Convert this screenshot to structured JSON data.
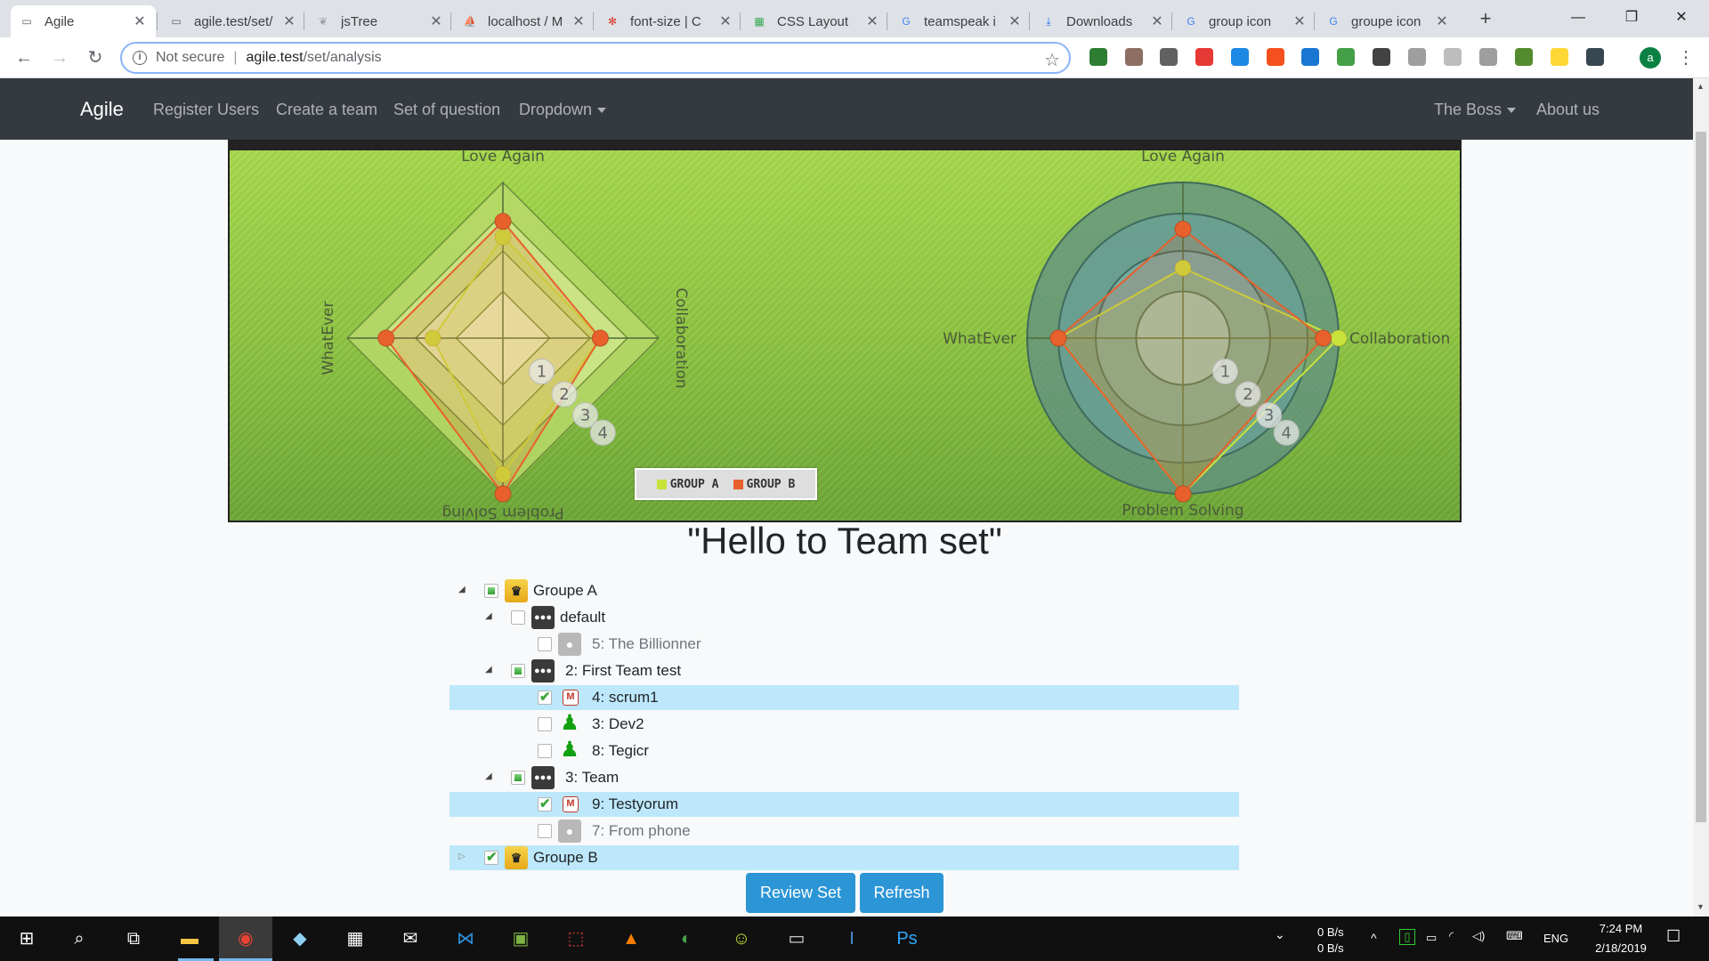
{
  "browser": {
    "tabs": [
      {
        "title": "Agile",
        "icon": "page-icon"
      },
      {
        "title": "agile.test/set/",
        "icon": "page-icon"
      },
      {
        "title": "jsTree",
        "icon": "jstree-icon"
      },
      {
        "title": "localhost / M",
        "icon": "phpmyadmin-icon"
      },
      {
        "title": "font-size | C",
        "icon": "codepen-icon"
      },
      {
        "title": "CSS Layout",
        "icon": "css-icon"
      },
      {
        "title": "teamspeak i",
        "icon": "google-icon"
      },
      {
        "title": "Downloads",
        "icon": "download-icon"
      },
      {
        "title": "group icon",
        "icon": "google-icon"
      },
      {
        "title": "groupe icon",
        "icon": "google-icon"
      }
    ],
    "address": {
      "security": "Not secure",
      "host": "agile.test",
      "path": "/set/analysis"
    },
    "profile_initial": "a",
    "colors": {
      "tabstrip": "#dee1e6",
      "omnibox_border": "#8ab4f8"
    }
  },
  "navbar": {
    "brand": "Agile",
    "links": [
      "Register Users",
      "Create a team",
      "Set of question",
      "Dropdown"
    ],
    "right_links": [
      "The Boss",
      "About us"
    ],
    "bg": "#343a40"
  },
  "chart_data": [
    {
      "type": "radar",
      "shape": "diamond",
      "axes": [
        "Love Again",
        "Collaboration",
        "Problem Solving",
        "WhatEver"
      ],
      "rings": [
        "1",
        "2",
        "3",
        "4"
      ],
      "max": 4,
      "series": [
        {
          "name": "GROUP A",
          "color": "#c8e23c",
          "values": [
            2.6,
            2.5,
            3.5,
            1.8
          ]
        },
        {
          "name": "GROUP B",
          "color": "#e8602c",
          "values": [
            3.0,
            2.5,
            4.0,
            3.0
          ]
        }
      ]
    },
    {
      "type": "radar",
      "shape": "circle",
      "axes": [
        "Love Again",
        "Collaboration",
        "Problem Solving",
        "WhatEver"
      ],
      "rings": [
        "1",
        "2",
        "3",
        "4"
      ],
      "max": 4,
      "series": [
        {
          "name": "GROUP A",
          "color": "#c8e23c",
          "values": [
            1.8,
            4.0,
            4.0,
            3.2
          ]
        },
        {
          "name": "GROUP B",
          "color": "#e8602c",
          "values": [
            2.8,
            3.6,
            4.0,
            3.2
          ]
        }
      ]
    }
  ],
  "legend": {
    "items": [
      {
        "label": "GROUP A",
        "color": "#c8e23c"
      },
      {
        "label": "GROUP B",
        "color": "#e8602c"
      }
    ]
  },
  "page": {
    "title": "\"Hello to Team set\""
  },
  "tree": [
    {
      "label": "Groupe A",
      "icon": "crown-icon",
      "check": "partial",
      "arrow": "open",
      "selected": false,
      "dim": false
    },
    {
      "label": "default",
      "icon": "group-icon",
      "check": "none",
      "arrow": "open",
      "selected": false,
      "dim": false
    },
    {
      "label": "5: The Billionner",
      "icon": "person-icon",
      "check": "none",
      "arrow": "",
      "selected": false,
      "dim": true
    },
    {
      "label": "2: First Team test",
      "icon": "group-icon",
      "check": "partial",
      "arrow": "open",
      "selected": false,
      "dim": false
    },
    {
      "label": "4: scrum1",
      "icon": "scrum-master-icon",
      "check": "full",
      "arrow": "",
      "selected": true,
      "dim": false
    },
    {
      "label": "3: Dev2",
      "icon": "developer-icon",
      "check": "none",
      "arrow": "",
      "selected": false,
      "dim": false
    },
    {
      "label": "8: Tegicr",
      "icon": "developer-icon",
      "check": "none",
      "arrow": "",
      "selected": false,
      "dim": false
    },
    {
      "label": "3: Team",
      "icon": "group-icon",
      "check": "partial",
      "arrow": "open",
      "selected": false,
      "dim": false
    },
    {
      "label": "9: Testyorum",
      "icon": "scrum-master-icon",
      "check": "full",
      "arrow": "",
      "selected": true,
      "dim": false
    },
    {
      "label": "7: From phone",
      "icon": "person-icon",
      "check": "none",
      "arrow": "",
      "selected": false,
      "dim": true
    },
    {
      "label": "Groupe B",
      "icon": "crown-icon",
      "check": "full",
      "arrow": "closed",
      "selected": true,
      "dim": false
    }
  ],
  "buttons": {
    "review": "Review Set",
    "refresh": "Refresh",
    "color": "#2b95d6"
  },
  "taskbar": {
    "net_up": "0 B/s",
    "net_down": "0 B/s",
    "lang": "ENG",
    "time": "7:24 PM",
    "date": "2/18/2019"
  }
}
